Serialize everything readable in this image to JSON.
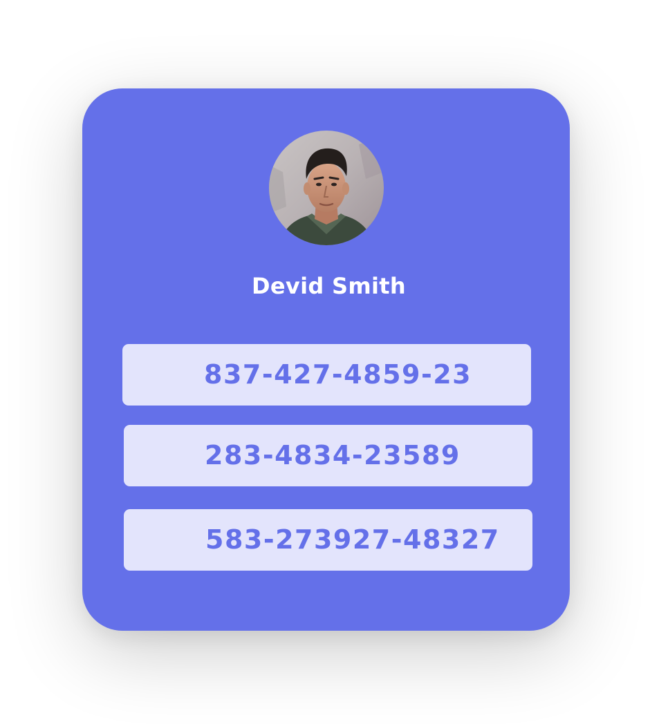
{
  "profile": {
    "name": "Devid Smith",
    "avatar_icon": "user-photo"
  },
  "phones": [
    {
      "number": "837-427-4859-23"
    },
    {
      "number": "283-4834-23589"
    },
    {
      "number": "583-273927-48327"
    }
  ],
  "colors": {
    "card_background": "#6470e9",
    "phone_background": "#e3e4fc",
    "phone_text": "#6470e9",
    "name_text": "#ffffff"
  }
}
